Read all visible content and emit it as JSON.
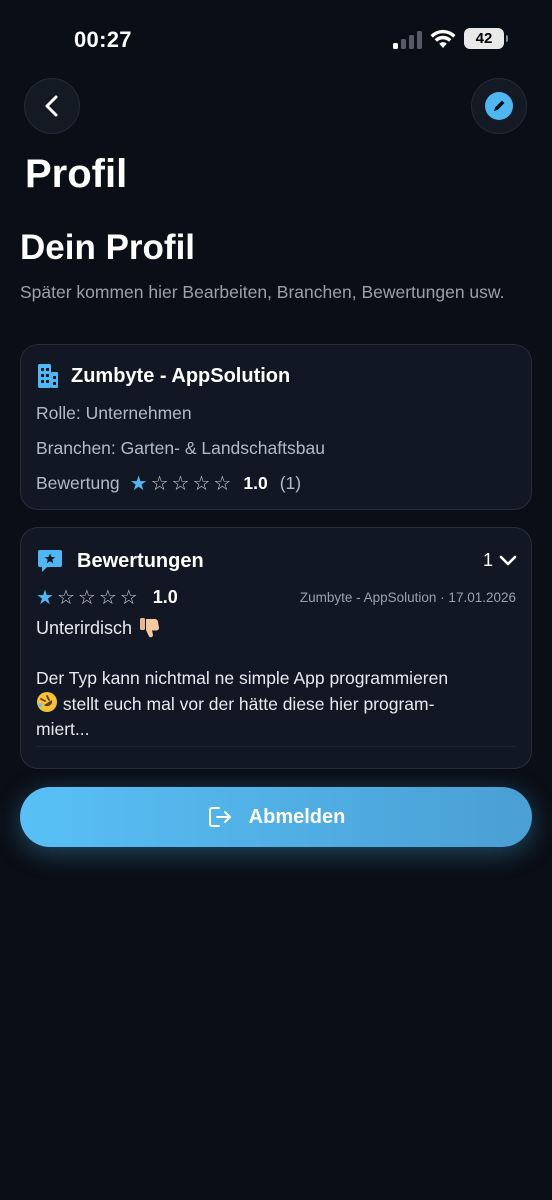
{
  "status_bar": {
    "time": "00:27",
    "battery": "42"
  },
  "nav": {
    "title": "Profil"
  },
  "section": {
    "title": "Dein Profil",
    "subtitle": "Später kommen hier Bearbeiten, Branchen, Bewertungen usw."
  },
  "profile": {
    "company": "Zumbyte - AppSolution",
    "role": "Rolle: Unternehmen",
    "branches": "Branchen: Garten- & Landschaftsbau",
    "rating_label": "Bewertung",
    "rating_value": "1.0",
    "rating_count": "(1)",
    "stars_filled": 1,
    "stars_total": 5
  },
  "reviews": {
    "title": "Bewertungen",
    "count": "1",
    "items": [
      {
        "stars_filled": 1,
        "rating": "1.0",
        "meta": "Zumbyte - AppSolution · 17.01.2026",
        "title": "Unterirdisch",
        "body_line1": "Der Typ kann nichtmal ne simple App programmieren",
        "body_line2": "stellt euch mal vor der hätte diese hier program-",
        "body_line3": "miert..."
      }
    ]
  },
  "logout": {
    "label": "Abmelden"
  },
  "colors": {
    "accent": "#4fb8f2",
    "background": "#0a0e16",
    "card": "#121823"
  }
}
